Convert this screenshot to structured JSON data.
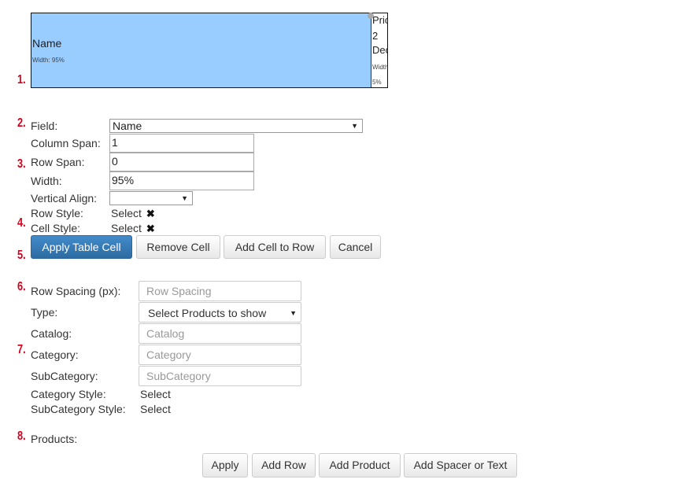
{
  "markers": [
    "1.",
    "2.",
    "3.",
    "4.",
    "5.",
    "6.",
    "7.",
    "8."
  ],
  "preview": {
    "main_cell": {
      "name": "Name",
      "width_text": "Width: 95%"
    },
    "side_cell": {
      "lines": [
        "Pric",
        "2",
        "Dec"
      ],
      "width_label": "Width",
      "width_value": "5%"
    }
  },
  "cell_form": {
    "field_label": "Field:",
    "field_value": "Name",
    "column_span_label": "Column Span:",
    "column_span_value": "1",
    "row_span_label": "Row Span:",
    "row_span_value": "0",
    "width_label": "Width:",
    "width_value": "95%",
    "vertical_align_label": "Vertical Align:",
    "vertical_align_value": "",
    "row_style_label": "Row Style:",
    "row_style_value": "Select",
    "cell_style_label": "Cell Style:",
    "cell_style_value": "Select"
  },
  "cell_buttons": {
    "apply": "Apply Table Cell",
    "remove": "Remove Cell",
    "add": "Add Cell to Row",
    "cancel": "Cancel"
  },
  "row_form": {
    "row_spacing_label": "Row Spacing (px):",
    "row_spacing_placeholder": "Row Spacing",
    "type_label": "Type:",
    "type_value": "Select Products to show",
    "catalog_label": "Catalog:",
    "catalog_placeholder": "Catalog",
    "category_label": "Category:",
    "category_placeholder": "Category",
    "subcategory_label": "SubCategory:",
    "subcategory_placeholder": "SubCategory",
    "category_style_label": "Category Style:",
    "category_style_value": "Select",
    "subcategory_style_label": "SubCategory Style:",
    "subcategory_style_value": "Select",
    "products_label": "Products:"
  },
  "bottom_buttons": {
    "apply": "Apply",
    "add_row": "Add Row",
    "add_product": "Add Product",
    "add_spacer": "Add Spacer or Text"
  },
  "colors": {
    "marker": "#d6001c",
    "cell_highlight": "#99ccff",
    "primary_button": "#337ab7"
  }
}
